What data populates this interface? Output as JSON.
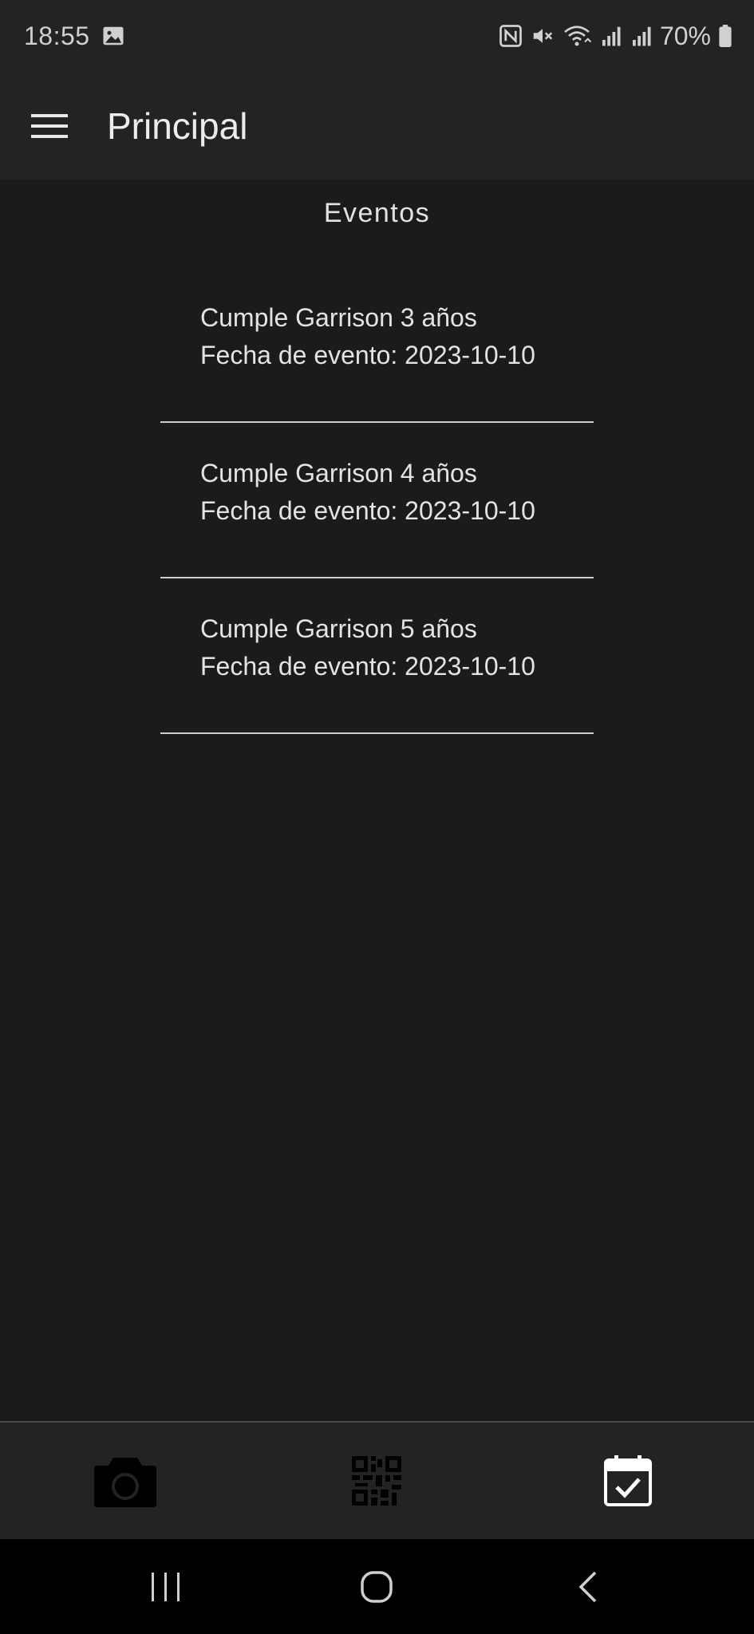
{
  "status_bar": {
    "time": "18:55",
    "battery_percent": "70%",
    "icons": [
      "gallery-icon",
      "nfc-icon",
      "mute-icon",
      "wifi-icon",
      "signal-icon",
      "signal-icon",
      "battery-icon"
    ]
  },
  "app_bar": {
    "title": "Principal",
    "menu_icon": "hamburger-menu-icon"
  },
  "main": {
    "section_title": "Eventos",
    "events": [
      {
        "name": "Cumple Garrison 3 años",
        "date_line": "Fecha de evento: 2023-10-10"
      },
      {
        "name": "Cumple Garrison 4 años",
        "date_line": "Fecha de evento: 2023-10-10"
      },
      {
        "name": "Cumple Garrison 5 años",
        "date_line": "Fecha de evento: 2023-10-10"
      }
    ]
  },
  "bottom_nav": {
    "items": [
      {
        "icon": "camera-icon",
        "active": false
      },
      {
        "icon": "qr-code-icon",
        "active": false
      },
      {
        "icon": "calendar-check-icon",
        "active": true
      }
    ],
    "colors": {
      "inactive": "#000000",
      "active": "#ffffff"
    }
  },
  "system_nav": {
    "icons": [
      "recent-apps-icon",
      "home-icon",
      "back-icon"
    ]
  },
  "colors": {
    "background": "#1b1b1b",
    "bars": "#232323",
    "text": "#e6e6e6"
  }
}
